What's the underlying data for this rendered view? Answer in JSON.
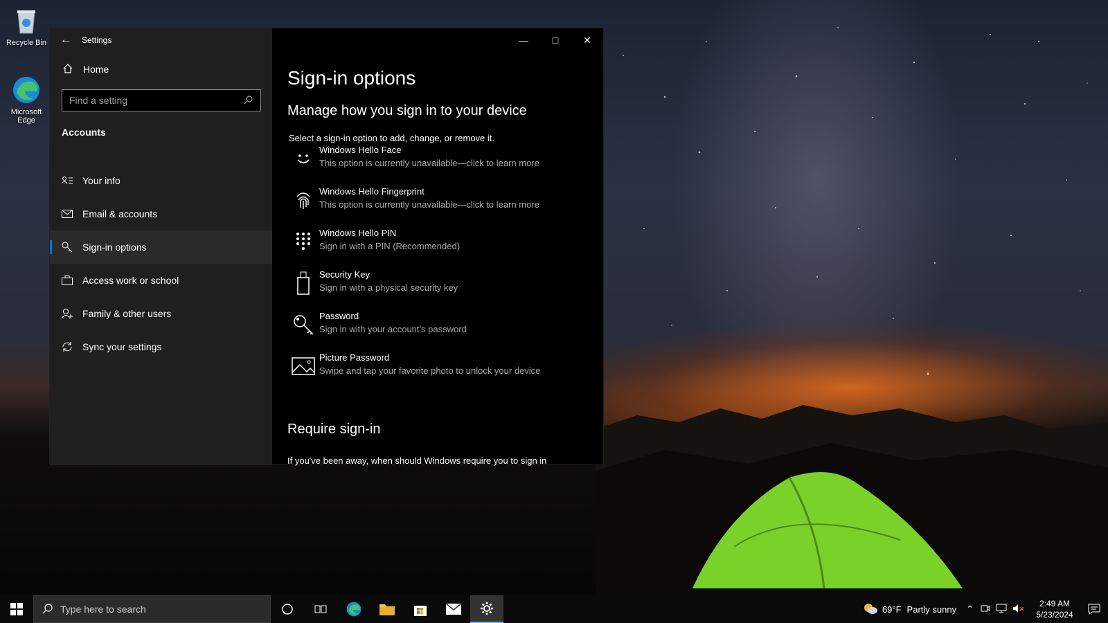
{
  "desktop": {
    "icons": [
      {
        "label": "Recycle Bin"
      },
      {
        "label": "Microsoft Edge"
      }
    ]
  },
  "window": {
    "app_title": "Settings",
    "sidebar": {
      "home": "Home",
      "search_placeholder": "Find a setting",
      "section": "Accounts",
      "items": [
        {
          "label": "Your info",
          "icon": "person-card-icon"
        },
        {
          "label": "Email & accounts",
          "icon": "mail-icon"
        },
        {
          "label": "Sign-in options",
          "icon": "key-icon",
          "active": true
        },
        {
          "label": "Access work or school",
          "icon": "briefcase-icon"
        },
        {
          "label": "Family & other users",
          "icon": "person-add-icon"
        },
        {
          "label": "Sync your settings",
          "icon": "sync-icon"
        }
      ]
    },
    "content": {
      "title": "Sign-in options",
      "subtitle": "Manage how you sign in to your device",
      "intro": "Select a sign-in option to add, change, or remove it.",
      "options": [
        {
          "title": "Windows Hello Face",
          "desc": "This option is currently unavailable—click to learn more",
          "icon": "face-icon"
        },
        {
          "title": "Windows Hello Fingerprint",
          "desc": "This option is currently unavailable—click to learn more",
          "icon": "fingerprint-icon"
        },
        {
          "title": "Windows Hello PIN",
          "desc": "Sign in with a PIN (Recommended)",
          "icon": "pin-keypad-icon"
        },
        {
          "title": "Security Key",
          "desc": "Sign in with a physical security key",
          "icon": "usb-key-icon"
        },
        {
          "title": "Password",
          "desc": "Sign in with your account's password",
          "icon": "key-icon"
        },
        {
          "title": "Picture Password",
          "desc": "Swipe and tap your favorite photo to unlock your device",
          "icon": "picture-icon"
        }
      ],
      "require_heading": "Require sign-in",
      "require_text": "If you've been away, when should Windows require you to sign in"
    }
  },
  "taskbar": {
    "search_placeholder": "Type here to search",
    "weather": {
      "temp": "69°F",
      "condition": "Partly sunny"
    },
    "clock": {
      "time": "2:49 AM",
      "date": "5/23/2024"
    },
    "accent": "#0078d7"
  }
}
